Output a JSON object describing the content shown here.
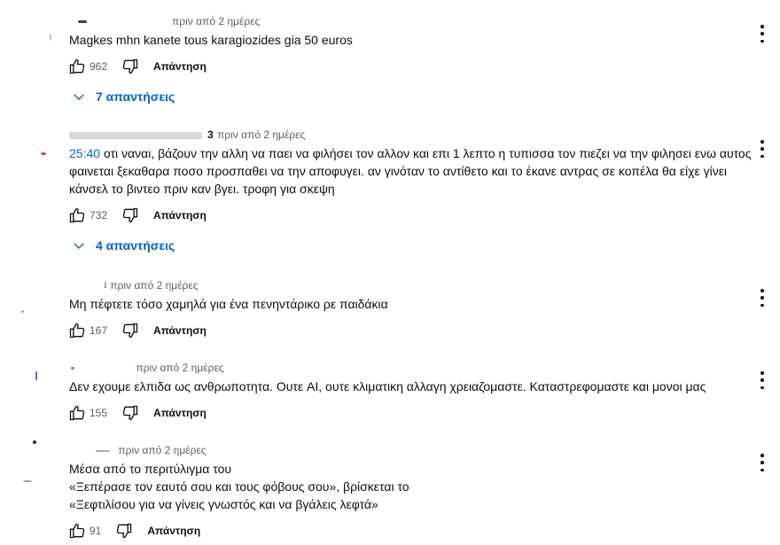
{
  "comments": [
    {
      "time": "πριν από 2 ημέρες",
      "text": "Magkes mhn kanete tous karagiozides gia 50 euros",
      "likes": "962",
      "reply_label": "Απάντηση",
      "replies_label": "7 απαντήσεις"
    },
    {
      "author_partial": "3",
      "time": "πριν από 2 ημέρες",
      "timestamp_link": "25:40",
      "text": " οτι ναναι, βάζουν την αλλη να παει να φιλήσει τον αλλον και επι 1 λεπτο η τυπισσα τον πιεζει να την φιλησει ενω αυτος φαινεται ξεκαθαρα ποσο προσπαθει να την αποφυγει. αν γινόταν το αντίθετο και το έκανε αντρας σε κοπέλα θα είχε γίνει κάνσελ το βιντεο πριν καν βγει. τροφη για σκεψη",
      "likes": "732",
      "reply_label": "Απάντηση",
      "replies_label": "4 απαντήσεις"
    },
    {
      "time": "πριν από 2 ημέρες",
      "text": "Μη πέφτετε τόσο χαμηλά για ένα πενηντάρικο ρε παιδάκια",
      "likes": "167",
      "reply_label": "Απάντηση"
    },
    {
      "time": "πριν από 2 ημέρες",
      "text": "Δεν εχουμε ελπιδα ως ανθρωποτητα. Ουτε AI, ουτε κλιματικη αλλαγη χρειαζομαστε. Καταστρεφομαστε και μονοι μας",
      "likes": "155",
      "reply_label": "Απάντηση"
    },
    {
      "time": "πριν από 2 ημέρες",
      "lines": [
        "Μέσα από το περιτύλιγμα του",
        "«Ξεπέρασε τον εαυτό σου και τους φόβους σου», βρίσκεται το",
        "«Ξεφτιλίσου για να γίνεις γνωστός και να βγάλεις λεφτά»"
      ],
      "likes": "91",
      "reply_label": "Απάντηση"
    }
  ]
}
